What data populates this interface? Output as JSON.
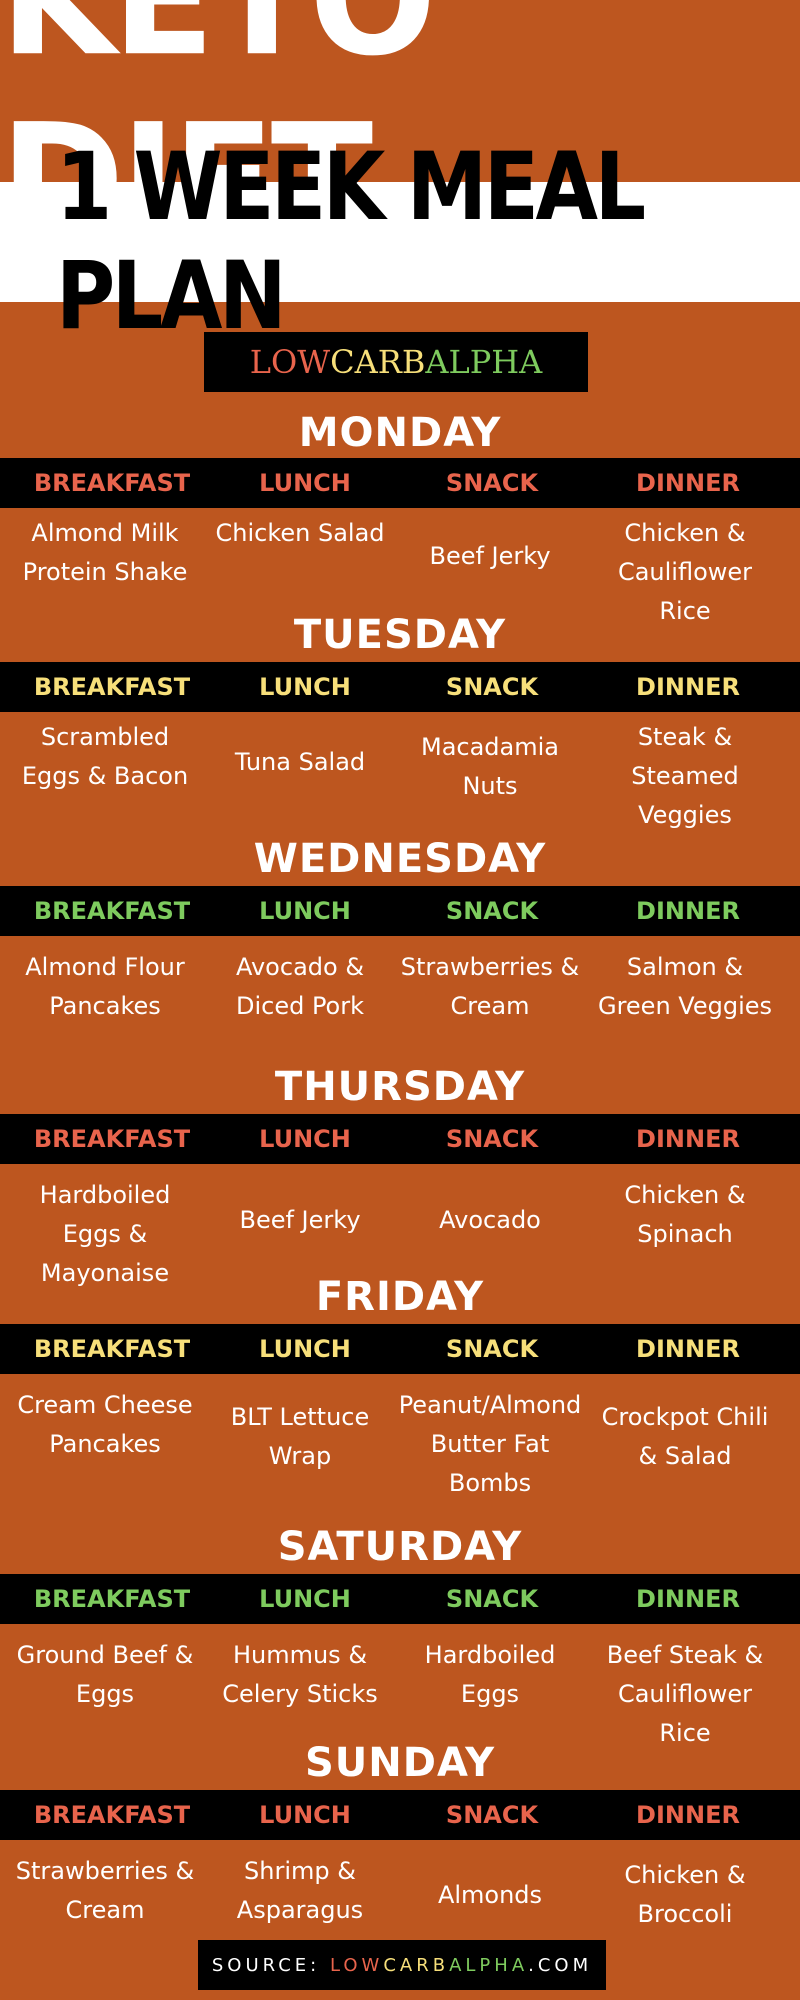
{
  "title_line1": "KETO DIET",
  "title_line2": "1 WEEK MEAL PLAN",
  "logo": {
    "low": "LOW",
    "carb": "CARB",
    "alpha": "ALPHA"
  },
  "colors": {
    "background": "#bd561f",
    "red": "#e8644c",
    "yellow": "#f7df7a",
    "green": "#7ecb5e",
    "band": "#000000"
  },
  "days": [
    {
      "name": "MONDAY",
      "header_color": "red",
      "headers": [
        "BREAKFAST",
        "LUNCH",
        "SNACK",
        "DINNER"
      ],
      "meals": [
        "Almond Milk Protein Shake",
        "Chicken Salad",
        "Beef Jerky",
        "Chicken & Cauliflower Rice"
      ]
    },
    {
      "name": "TUESDAY",
      "header_color": "yellow",
      "headers": [
        "BREAKFAST",
        "LUNCH",
        "SNACK",
        "DINNER"
      ],
      "meals": [
        "Scrambled Eggs & Bacon",
        "Tuna Salad",
        "Macadamia Nuts",
        "Steak & Steamed Veggies"
      ]
    },
    {
      "name": "WEDNESDAY",
      "header_color": "green",
      "headers": [
        "BREAKFAST",
        "LUNCH",
        "SNACK",
        "DINNER"
      ],
      "meals": [
        "Almond Flour Pancakes",
        "Avocado & Diced Pork",
        "Strawberries & Cream",
        "Salmon & Green Veggies"
      ]
    },
    {
      "name": "THURSDAY",
      "header_color": "red",
      "headers": [
        "BREAKFAST",
        "LUNCH",
        "SNACK",
        "DINNER"
      ],
      "meals": [
        "Hardboiled Eggs & Mayonaise",
        "Beef Jerky",
        "Avocado",
        "Chicken & Spinach"
      ]
    },
    {
      "name": "FRIDAY",
      "header_color": "yellow",
      "headers": [
        "BREAKFAST",
        "LUNCH",
        "SNACK",
        "DINNER"
      ],
      "meals": [
        "Cream Cheese Pancakes",
        "BLT Lettuce Wrap",
        "Peanut/Almond Butter Fat Bombs",
        "Crockpot Chili & Salad"
      ]
    },
    {
      "name": "SATURDAY",
      "header_color": "green",
      "headers": [
        "BREAKFAST",
        "LUNCH",
        "SNACK",
        "DINNER"
      ],
      "meals": [
        "Ground Beef & Eggs",
        "Hummus & Celery Sticks",
        "Hardboiled Eggs",
        "Beef Steak & Cauliflower Rice"
      ]
    },
    {
      "name": "SUNDAY",
      "header_color": "red",
      "headers": [
        "BREAKFAST",
        "LUNCH",
        "SNACK",
        "DINNER"
      ],
      "meals": [
        "Strawberries & Cream",
        "Shrimp & Asparagus",
        "Almonds",
        "Chicken & Broccoli"
      ]
    }
  ],
  "source": {
    "label": "SOURCE:",
    "low": "LOW",
    "carb": "CARB",
    "alpha": "ALPHA",
    "domain": ".COM"
  }
}
